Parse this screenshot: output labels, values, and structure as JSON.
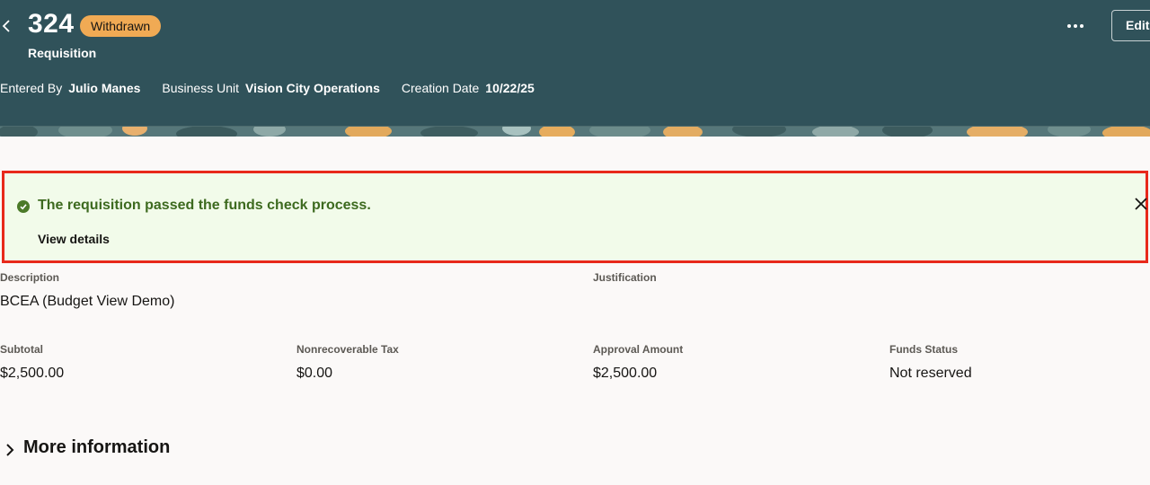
{
  "header": {
    "number": "324",
    "status": "Withdrawn",
    "type": "Requisition",
    "edit_label": "Edit",
    "meta": [
      {
        "label": "Entered By",
        "value": "Julio Manes"
      },
      {
        "label": "Business Unit",
        "value": "Vision City Operations"
      },
      {
        "label": "Creation Date",
        "value": "10/22/25"
      }
    ]
  },
  "message": {
    "text": "The requisition passed the funds check process.",
    "link": "View details",
    "icon": "check-circle-icon"
  },
  "fields": {
    "description": {
      "label": "Description",
      "value": "BCEA (Budget View Demo)"
    },
    "justification": {
      "label": "Justification",
      "value": ""
    },
    "subtotal": {
      "label": "Subtotal",
      "value": "$2,500.00"
    },
    "nonrecoverable_tax": {
      "label": "Nonrecoverable Tax",
      "value": "$0.00"
    },
    "approval_amount": {
      "label": "Approval Amount",
      "value": "$2,500.00"
    },
    "funds_status": {
      "label": "Funds Status",
      "value": "Not reserved"
    }
  },
  "more_information": {
    "label": "More information"
  },
  "colors": {
    "header_bg": "#30525a",
    "badge_bg": "#f0aa54",
    "success_bg": "#f2fbea",
    "success_text": "#3d6a1f",
    "highlight_border": "#e8291b"
  }
}
